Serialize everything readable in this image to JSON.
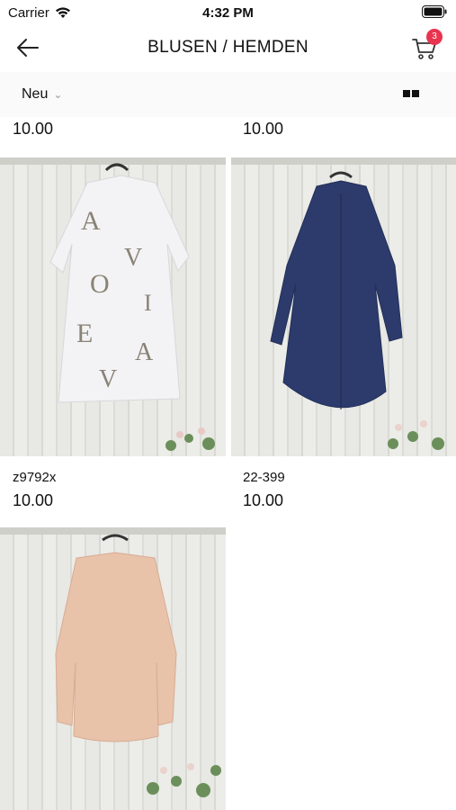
{
  "status": {
    "carrier": "Carrier",
    "time": "4:32 PM"
  },
  "nav": {
    "title": "BLUSEN / HEMDEN",
    "cart_count": "3"
  },
  "sort": {
    "label": "Neu"
  },
  "top_prices": [
    "10.00",
    "10.00"
  ],
  "products": [
    {
      "name": "z9792x",
      "price": "10.00"
    },
    {
      "name": "22-399",
      "price": "10.00"
    },
    {
      "name": "",
      "price": ""
    }
  ],
  "colors": {
    "badge": "#e8344e",
    "shirt_white": "#f3f3f5",
    "shirt_navy": "#2c3b6b",
    "shirt_peach": "#e9c2aa"
  }
}
